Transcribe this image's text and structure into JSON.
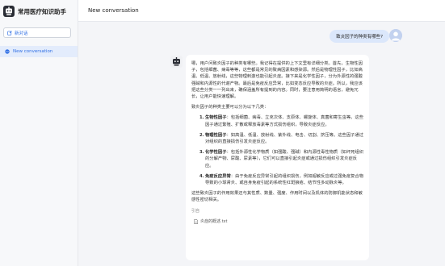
{
  "sidebar": {
    "app_title": "常用医疗知识助手",
    "new_chat_label": "新对话",
    "conversations": [
      {
        "label": "New conversation"
      }
    ]
  },
  "header": {
    "title": "New conversation"
  },
  "chat": {
    "user_message": "致炎因子的种类有哪些?",
    "assistant": {
      "intro": "嗯，用户问致炎因子的种类有哪些。我记得在提供的上下文里有详细分类。首先，生物性因子，包括细菌、病毒等等，这些都是常见的致病因素和感染源。然后是物理性因子，比如高温、低温、放射线，这些物理刺激也能引起炎症。接下来是化学性因子，分为外源性的强酸强碱和内源性的代谢产物。最后是免疫反应异常，比如变态反应导致的炎症。所以，我应该把这些分类一一列出来，确保涵盖所有提到的内容。同时，要注意用简明的语言，避免冗长，让用户能快速理解。",
      "summary": "致炎因子的种类主要可以分为以下几类：",
      "items": [
        {
          "num": "1.",
          "term": "生物性因子",
          "desc": "：包括细菌、病毒、立克次体、支原体、螺旋体、真菌和寄生虫等。这些因子通过繁殖、扩散或释放毒素等方式损伤组织，导致炎症反应。"
        },
        {
          "num": "2.",
          "term": "物理性因子",
          "desc": "：如高温、低温、放射线、紫外线、电击、切割、挤压等。这些因子通过对组织的直接损伤引发炎症反应。"
        },
        {
          "num": "3.",
          "term": "化学性因子",
          "desc": "：包括外源性化学物质（如强酸、强碱）和内源性毒性物质（如坏死组织的分解产物、尿酸、尿素等），它们可以直接引起炎症或通过损伤组织引发炎症反应。"
        },
        {
          "num": "4.",
          "term": "免疫反应异常",
          "desc": "：由于免疫反应异常引起的组织损伤，例如超敏反应或过强免疫复合物导致的小球肾炎、或自身免疫引起的系统性红斑狼疮、结节性多动脉炎等。"
        }
      ],
      "conclusion": "这些致炎因子的作用效果还与其性质、数量、强度、作用时间以及机体的防御机能状态和敏感性密切相关。",
      "references_label": "引自",
      "reference_file": "炎症的概述.txt"
    }
  },
  "colors": {
    "accent": "#2f6fe4",
    "user_bubble": "#dbe7fb",
    "active_conversation": "#e3ecfc"
  },
  "icons": {
    "logo": "medical-assistant-logo",
    "new_chat": "edit-icon",
    "conversation": "chat-bubble-icon",
    "file": "document-icon"
  }
}
